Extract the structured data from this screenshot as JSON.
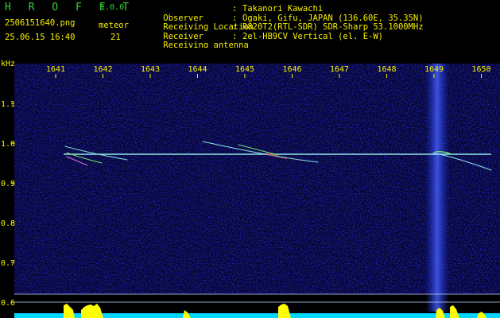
{
  "header": {
    "logo": "H R O F F T",
    "version": "1.0.0",
    "filename": "2506151640.png",
    "datetime": "25.06.15 16:40",
    "count_label": "meteor",
    "count_value": "21",
    "info": [
      {
        "label": "Observer",
        "value": "Takanori Kawachi"
      },
      {
        "label": "Receiving Location",
        "value": "Ogaki, Gifu, JAPAN (136.60E, 35.35N)"
      },
      {
        "label": "Receiver",
        "value": "R820T2(RTL-SDR) SDR-Sharp 53.1000MHz"
      },
      {
        "label": "Receiving antenna",
        "value": "2el-HB9CV Vertical (el. E-W)"
      }
    ]
  },
  "plot": {
    "y_unit": "kHz",
    "time_ticks": [
      "1641",
      "1642",
      "1643",
      "1644",
      "1645",
      "1646",
      "1647",
      "1648",
      "1649",
      "1650"
    ],
    "freq_ticks": [
      "1.1",
      "1.0",
      "0.9",
      "0.8",
      "0.7",
      "0.6"
    ],
    "colors": {
      "background": "#000000",
      "noise": "#0b0b8f",
      "text": "#f7f000",
      "logo": "#36d13a",
      "trace": "#8fe6e6",
      "activity": "#ffff00",
      "baseline": "#00d8ff"
    }
  }
}
